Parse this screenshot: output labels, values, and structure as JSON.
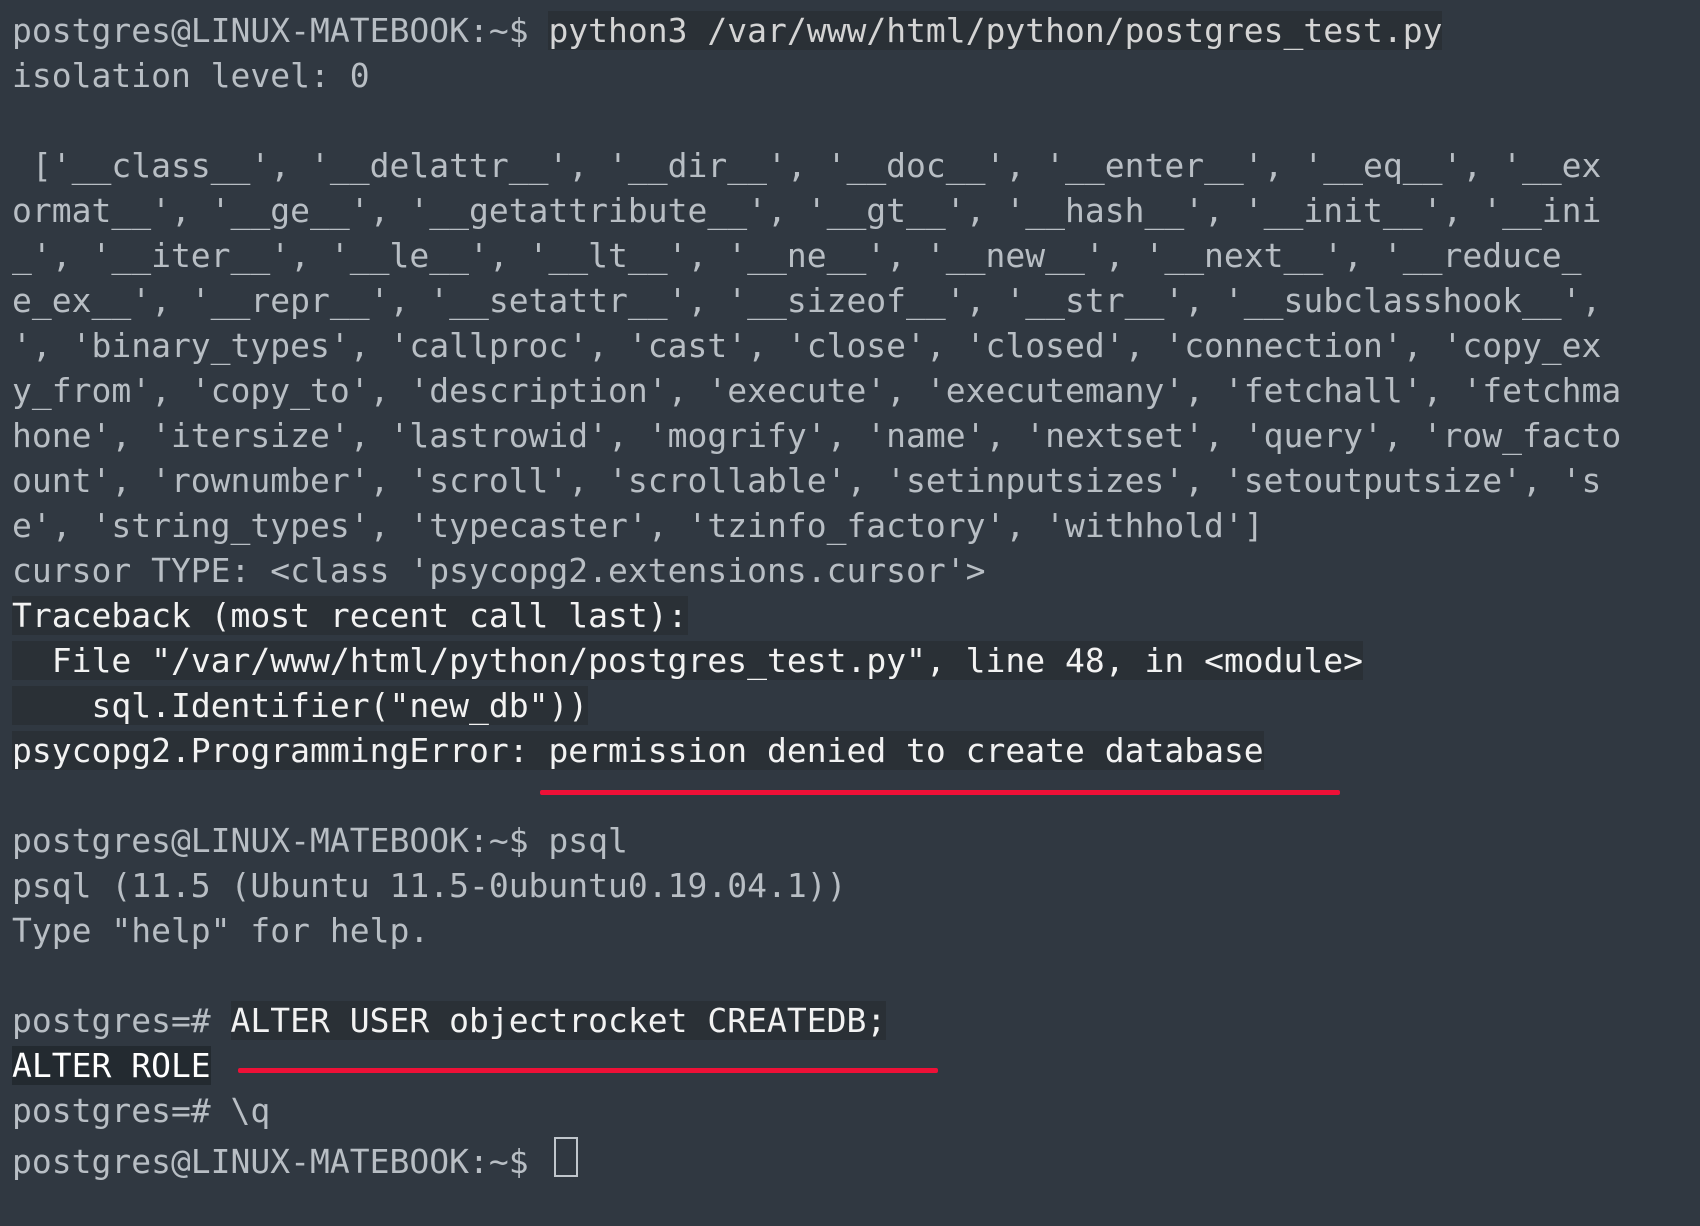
{
  "prompt1": "postgres@LINUX-MATEBOOK:~$ ",
  "cmd1": "python3 /var/www/html/python/postgres_test.py",
  "out_iso": "isolation level: 0",
  "blank1": "",
  "out_dir1": " ['__class__', '__delattr__', '__dir__', '__doc__', '__enter__', '__eq__', '__ex",
  "out_dir2": "ormat__', '__ge__', '__getattribute__', '__gt__', '__hash__', '__init__', '__ini",
  "out_dir3": "_', '__iter__', '__le__', '__lt__', '__ne__', '__new__', '__next__', '__reduce_",
  "out_dir4": "e_ex__', '__repr__', '__setattr__', '__sizeof__', '__str__', '__subclasshook__',",
  "out_dir5": "', 'binary_types', 'callproc', 'cast', 'close', 'closed', 'connection', 'copy_ex",
  "out_dir6": "y_from', 'copy_to', 'description', 'execute', 'executemany', 'fetchall', 'fetchma",
  "out_dir7": "hone', 'itersize', 'lastrowid', 'mogrify', 'name', 'nextset', 'query', 'row_facto",
  "out_dir8": "ount', 'rownumber', 'scroll', 'scrollable', 'setinputsizes', 'setoutputsize', 's",
  "out_dir9": "e', 'string_types', 'typecaster', 'tzinfo_factory', 'withhold']",
  "out_type": "cursor TYPE: <class 'psycopg2.extensions.cursor'>",
  "tb1": "Traceback (most recent call last):",
  "tb2": "  File \"/var/www/html/python/postgres_test.py\", line 48, in <module>",
  "tb3": "    sql.Identifier(\"new_db\"))",
  "tb4a": "psycopg2.ProgrammingError: ",
  "tb4b": "permission denied to create database",
  "blank2": "",
  "prompt2": "postgres@LINUX-MATEBOOK:~$ psql",
  "psql_ver": "psql (11.5 (Ubuntu 11.5-0ubuntu0.19.04.1))",
  "psql_help": "Type \"help\" for help.",
  "blank3": "",
  "pg_prompt1": "postgres=# ",
  "alter_stmt": "ALTER USER objectrocket CREATEDB;",
  "alter_role": "ALTER ROLE",
  "pg_prompt2": "postgres=# \\q",
  "prompt3": "postgres@LINUX-MATEBOOK:~$ "
}
